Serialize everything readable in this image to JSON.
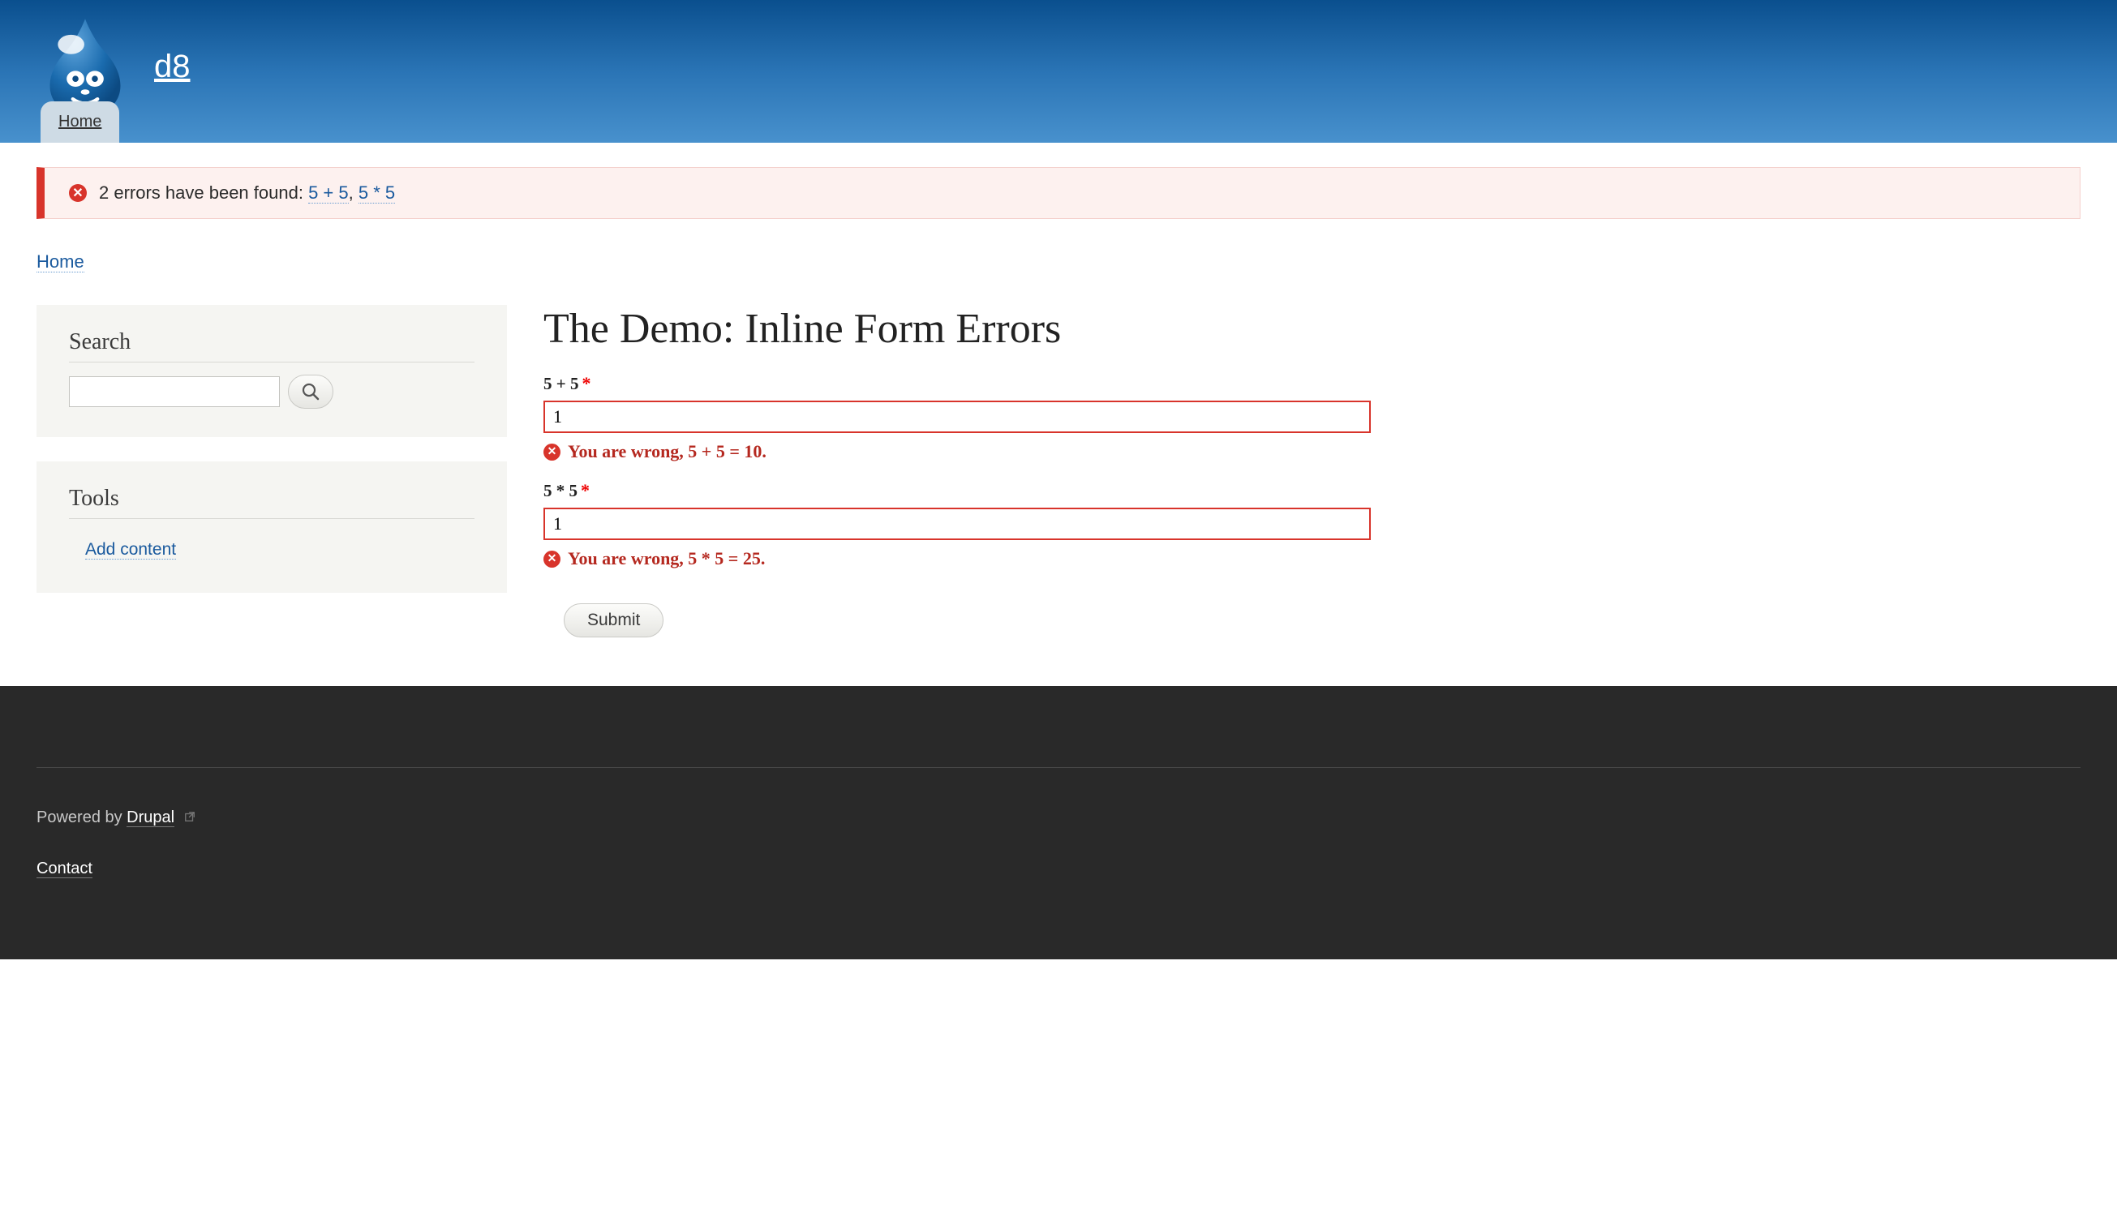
{
  "site": {
    "name": "d8"
  },
  "nav": {
    "home": "Home"
  },
  "messages": {
    "error_prefix": "2 errors have been found:",
    "link1": "5 + 5",
    "sep": ", ",
    "link2": "5 * 5"
  },
  "breadcrumb": {
    "home": "Home"
  },
  "sidebar": {
    "search": {
      "title": "Search"
    },
    "tools": {
      "title": "Tools",
      "add_content": "Add content"
    }
  },
  "page": {
    "title": "The Demo: Inline Form Errors",
    "field1": {
      "label": "5 + 5",
      "value": "1",
      "error": "You are wrong, 5 + 5 = 10."
    },
    "field2": {
      "label": "5 * 5",
      "value": "1",
      "error": "You are wrong, 5 * 5 = 25."
    },
    "submit": "Submit"
  },
  "footer": {
    "powered_prefix": "Powered by ",
    "powered_link": "Drupal",
    "contact": "Contact"
  }
}
